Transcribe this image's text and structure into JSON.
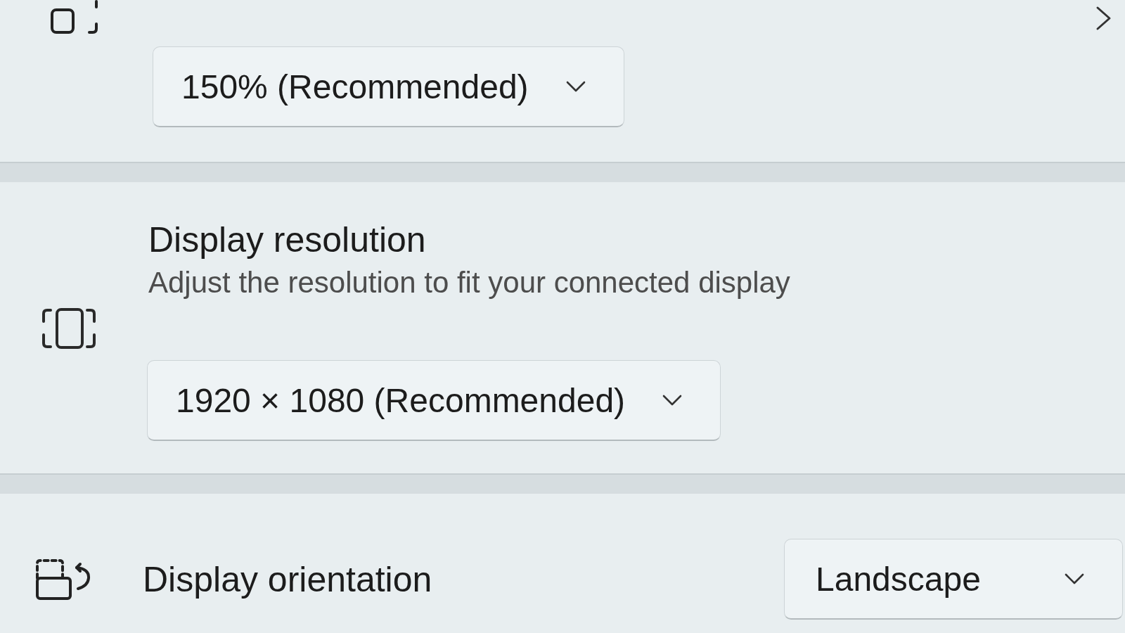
{
  "sections": [
    {
      "kind": "stacked",
      "dropdown": {
        "value": "150% (Recommended)"
      }
    },
    {
      "kind": "stacked",
      "title": "Display resolution",
      "subtitle": "Adjust the resolution to fit your connected display",
      "dropdown": {
        "value": "1920 × 1080 (Recommended)"
      }
    },
    {
      "kind": "inline",
      "title": "Display orientation",
      "dropdown": {
        "value": "Landscape"
      }
    }
  ]
}
